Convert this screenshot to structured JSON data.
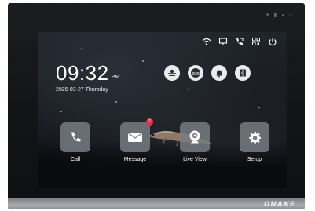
{
  "status_bar": {
    "icons": [
      "wifi-icon",
      "monitor-icon",
      "phone-forward-icon",
      "qr-code-icon",
      "power-icon"
    ]
  },
  "clock": {
    "time": "09:32",
    "ampm": "PM",
    "date": "2025-03-27 Thursday"
  },
  "quick_actions": [
    {
      "icon": "privacy-user-icon"
    },
    {
      "icon": "sos-icon",
      "text": "SOS"
    },
    {
      "icon": "bell-icon"
    },
    {
      "icon": "door-unlock-icon"
    }
  ],
  "apps": [
    {
      "label": "Call",
      "icon": "phone-icon"
    },
    {
      "label": "Message",
      "icon": "envelope-icon",
      "badge": "2"
    },
    {
      "label": "Live View",
      "icon": "camera-icon"
    },
    {
      "label": "Setup",
      "icon": "gear-icon"
    }
  ],
  "device": {
    "brand": "DNAKE"
  },
  "colors": {
    "tile": "#7a7d82",
    "badge": "#e2334a",
    "quick_bg": "#e9ebee"
  }
}
